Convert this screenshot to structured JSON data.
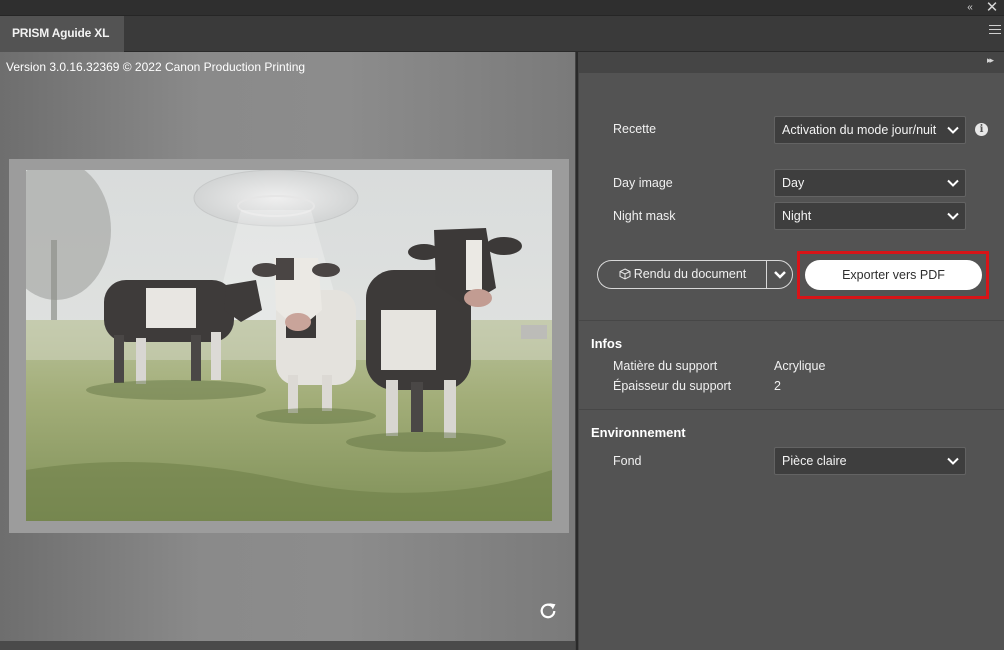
{
  "window": {
    "collapse_glyph": "«",
    "close_glyph": "✕"
  },
  "tab": {
    "title": "PRISM Aguide XL"
  },
  "preview": {
    "version_text": "Version 3.0.16.32369 © 2022 Canon Production Printing",
    "rotate_icon": "rotate-icon"
  },
  "panel": {
    "expand_glyph": "▸▸",
    "recette_label": "Recette",
    "recette_value": "Activation du mode jour/nuit",
    "day_image_label": "Day image",
    "day_image_value": "Day",
    "night_mask_label": "Night mask",
    "night_mask_value": "Night",
    "render_label": "Rendu du document",
    "export_label": "Exporter vers PDF",
    "highlight_color": "#d81418"
  },
  "infos": {
    "title": "Infos",
    "material_label": "Matière du support",
    "material_value": "Acrylique",
    "thickness_label": "Épaisseur du support",
    "thickness_value": "2"
  },
  "environment": {
    "title": "Environnement",
    "background_label": "Fond",
    "background_value": "Pièce claire"
  }
}
